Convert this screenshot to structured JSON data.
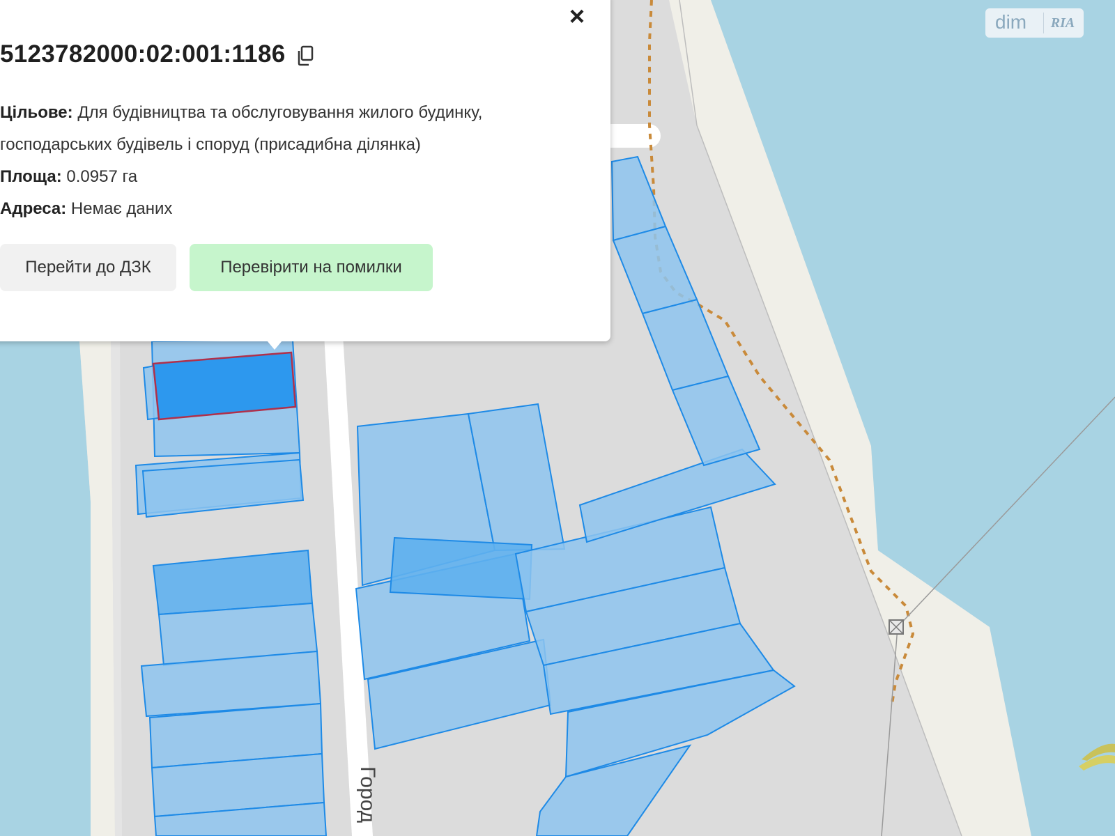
{
  "popup": {
    "cadastral_number": "5123782000:02:001:1186",
    "purpose_label": "Цільове:",
    "purpose_line1": "Для будівництва та обслуговування жилого будинку,",
    "purpose_line2": "господарських будівель і споруд (присадибна ділянка)",
    "area_label": "Площа:",
    "area_value": "0.0957 га",
    "address_label": "Адреса:",
    "address_value": "Немає даних",
    "btn_dzk": "Перейти до ДЗК",
    "btn_check": "Перевірити на помилки"
  },
  "map": {
    "street_label": "Город",
    "colors": {
      "water": "#a8d3e3",
      "land": "#dcdcdc",
      "beach": "#f0efe8",
      "parcel_fill": "#8ec4ef",
      "parcel_stroke": "#1e8ae6",
      "selected_stroke": "#b0304a",
      "path": "#c98a3a"
    }
  },
  "logo": {
    "dim": "dim",
    "ria": "RIA"
  },
  "icons": {
    "close": "close-icon",
    "copy": "copy-icon",
    "marker": "square-marker-icon"
  }
}
